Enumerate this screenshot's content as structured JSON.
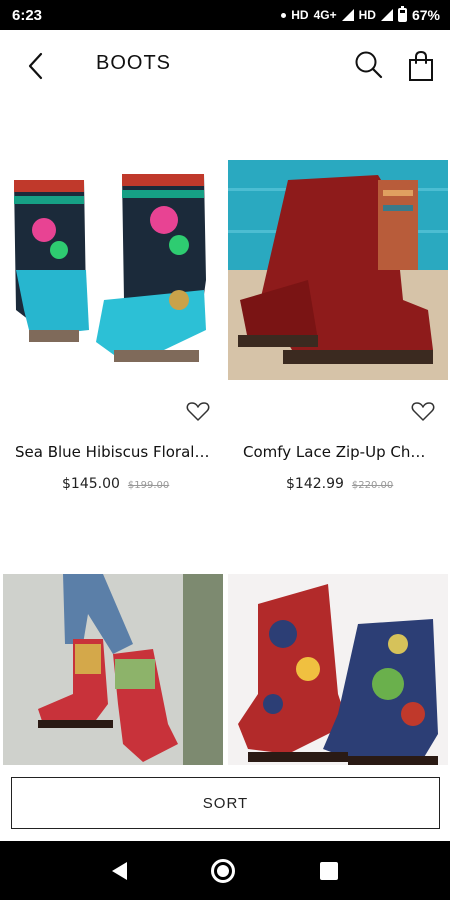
{
  "status_bar": {
    "time": "6:23",
    "network_1": "HD",
    "network_2": "4G+",
    "network_3": "HD",
    "battery": "67%"
  },
  "header": {
    "title": "BOOTS",
    "icons": [
      "back-arrow-icon",
      "search-icon",
      "shopping-bag-icon"
    ]
  },
  "products": [
    {
      "name": "Sea Blue Hibiscus Floral…",
      "price": "$145.00",
      "original_price": "$199.00",
      "image": "turquoise-embroidered-boots"
    },
    {
      "name": "Comfy Lace Zip-Up Ch…",
      "price": "$142.99",
      "original_price": "$220.00",
      "image": "red-lace-up-boot"
    },
    {
      "name": "",
      "price": "",
      "original_price": "",
      "image": "red-floral-boots-on-model"
    },
    {
      "name": "",
      "price": "",
      "original_price": "",
      "image": "red-paisley-boots"
    }
  ],
  "sort": {
    "label": "SORT"
  },
  "colors": {
    "accent": "#111111",
    "old_price": "#999999",
    "background": "#ffffff"
  }
}
